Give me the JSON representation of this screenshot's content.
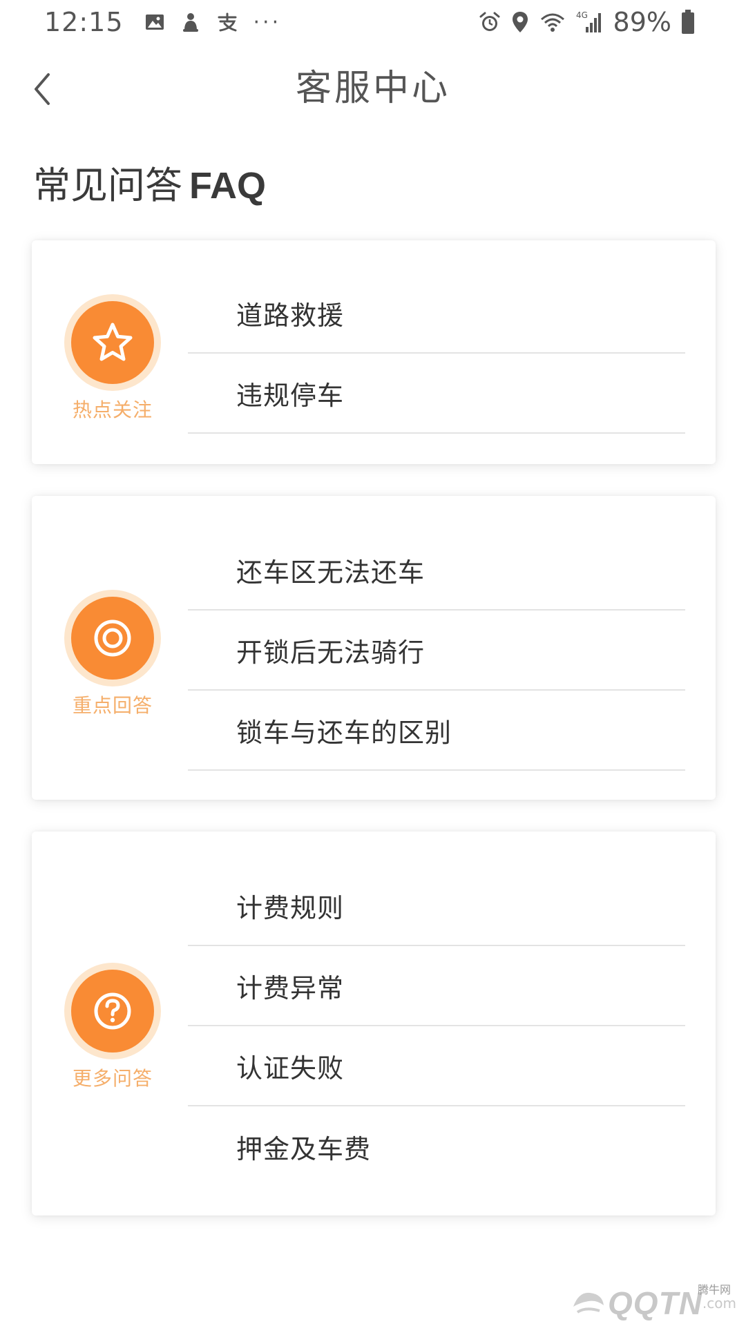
{
  "status_bar": {
    "time": "12:15",
    "left_icons": [
      "gallery-icon",
      "app-icon",
      "alipay-icon",
      "more-dots-icon"
    ],
    "more": "···",
    "right_icons": [
      "alarm-icon",
      "location-icon",
      "wifi-icon",
      "signal-4g-icon",
      "battery-icon"
    ],
    "network": "4G",
    "battery": "89%"
  },
  "header": {
    "title": "客服中心"
  },
  "faq": {
    "title_cn": "常见问答",
    "title_en": "FAQ",
    "sections": [
      {
        "badge_label": "热点关注",
        "icon": "star-icon",
        "items": [
          "道路救援",
          "违规停车"
        ]
      },
      {
        "badge_label": "重点回答",
        "icon": "target-icon",
        "items": [
          "还车区无法还车",
          "开锁后无法骑行",
          "锁车与还车的区别"
        ]
      },
      {
        "badge_label": "更多问答",
        "icon": "question-icon",
        "items": [
          "计费规则",
          "计费异常",
          "认证失败",
          "押金及车费"
        ]
      }
    ]
  },
  "watermark": {
    "text": "QQTN",
    "suffix": ".com",
    "small": "腾牛网"
  },
  "colors": {
    "accent": "#f98b34",
    "accent_light": "#fde6cc",
    "badge_text": "#f5ae6a",
    "divider": "#e3e3e3"
  }
}
